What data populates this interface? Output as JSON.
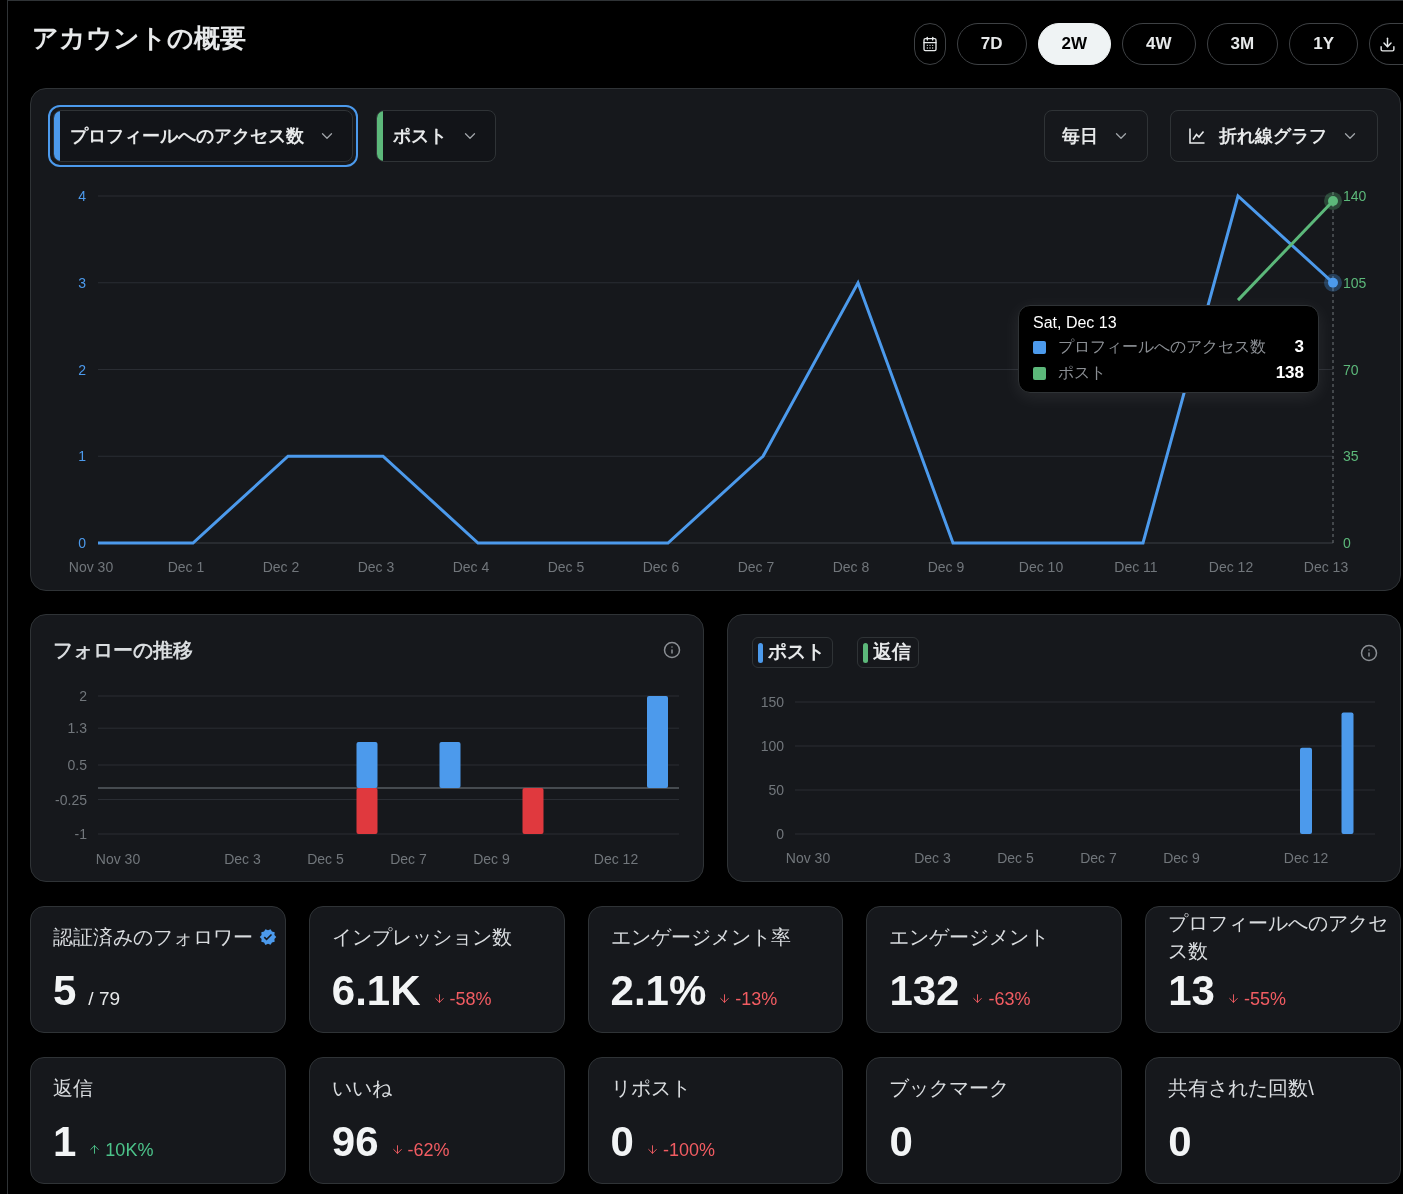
{
  "header": {
    "title": "アカウントの概要",
    "ranges": [
      {
        "label": "7D",
        "selected": false
      },
      {
        "label": "2W",
        "selected": true
      },
      {
        "label": "4W",
        "selected": false
      },
      {
        "label": "3M",
        "selected": false
      },
      {
        "label": "1Y",
        "selected": false
      }
    ]
  },
  "main_chart": {
    "metric_selectors": [
      {
        "label": "プロフィールへのアクセス数",
        "color": "#4c9aec",
        "focused": true
      },
      {
        "label": "ポスト",
        "color": "#5cb87a",
        "focused": false
      }
    ],
    "interval_selector": {
      "label": "毎日"
    },
    "chart_type_selector": {
      "label": "折れ線グラフ"
    },
    "chart_data": {
      "type": "line",
      "categories": [
        "Nov 30",
        "Dec 1",
        "Dec 2",
        "Dec 3",
        "Dec 4",
        "Dec 5",
        "Dec 6",
        "Dec 7",
        "Dec 8",
        "Dec 9",
        "Dec 10",
        "Dec 11",
        "Dec 12",
        "Dec 13"
      ],
      "series": [
        {
          "name": "プロフィールへのアクセス数",
          "color": "#4c9aec",
          "values": [
            0,
            0,
            1,
            1,
            0,
            0,
            0,
            1,
            3,
            0,
            0,
            0,
            4,
            3
          ]
        },
        {
          "name": "ポスト",
          "color": "#5cb87a",
          "axis": "y2",
          "values": [
            null,
            null,
            null,
            null,
            null,
            null,
            null,
            null,
            null,
            null,
            null,
            null,
            98,
            138
          ]
        }
      ],
      "ylim": [
        0,
        4
      ],
      "yticks": [
        0,
        1,
        2,
        3,
        4
      ],
      "y2lim": [
        0,
        140
      ],
      "y2ticks": [
        0,
        35,
        70,
        105,
        140
      ],
      "grid": true
    },
    "tooltip": {
      "title": "Sat, Dec 13",
      "values": [
        "3",
        "138"
      ]
    }
  },
  "follow_chart": {
    "title": "フォローの推移",
    "chart_data": {
      "type": "bar",
      "categories": [
        "Nov 30",
        null,
        null,
        "Dec 3",
        null,
        "Dec 5",
        null,
        "Dec 7",
        null,
        "Dec 9",
        null,
        null,
        "Dec 12",
        null
      ],
      "series": [
        {
          "color": "#4c9aec",
          "values": [
            0,
            0,
            0,
            0,
            0,
            0,
            1,
            0,
            1,
            0,
            0,
            0,
            0,
            2
          ]
        },
        {
          "color": "#e0393e",
          "values": [
            0,
            0,
            0,
            0,
            0,
            0,
            -1,
            0,
            0,
            0,
            -1,
            0,
            0,
            0
          ]
        }
      ],
      "ylim": [
        -1,
        2
      ],
      "yticks": [
        2,
        1.3,
        0.5,
        -0.25,
        -1
      ],
      "grid": true,
      "stacked": true
    }
  },
  "posts_chart": {
    "chart_data": {
      "type": "bar",
      "categories": [
        "Nov 30",
        null,
        null,
        "Dec 3",
        null,
        "Dec 5",
        null,
        "Dec 7",
        null,
        "Dec 9",
        null,
        null,
        "Dec 12",
        null
      ],
      "series": [
        {
          "name": "ポスト",
          "color": "#4c9aec",
          "values": [
            0,
            0,
            0,
            0,
            0,
            0,
            0,
            0,
            0,
            0,
            0,
            0,
            98,
            138
          ]
        },
        {
          "name": "返信",
          "color": "#5cb87a",
          "values": [
            0,
            0,
            0,
            0,
            0,
            0,
            0,
            0,
            0,
            0,
            0,
            0,
            0,
            0
          ]
        }
      ],
      "ylim": [
        0,
        150
      ],
      "yticks": [
        150,
        100,
        50,
        0
      ],
      "grid": true,
      "stacked": true
    }
  },
  "stats": [
    {
      "label": "認証済みのフォロワー",
      "verified": true,
      "value": "5",
      "suffix": "/ 79"
    },
    {
      "label": "インプレッション数",
      "verified": false,
      "value": "6.1K",
      "change": "-58%",
      "kind": "down"
    },
    {
      "label": "エンゲージメント率",
      "verified": false,
      "value": "2.1%",
      "change": "-13%",
      "kind": "down"
    },
    {
      "label": "エンゲージメント",
      "verified": false,
      "value": "132",
      "change": "-63%",
      "kind": "down"
    },
    {
      "label": "プロフィールへのアクセス数",
      "verified": false,
      "value": "13",
      "change": "-55%",
      "kind": "down"
    },
    {
      "label": "返信",
      "verified": false,
      "value": "1",
      "change": "10K%",
      "kind": "up"
    },
    {
      "label": "いいね",
      "verified": false,
      "value": "96",
      "change": "-62%",
      "kind": "down"
    },
    {
      "label": "リポスト",
      "verified": false,
      "value": "0",
      "change": "-100%",
      "kind": "down"
    },
    {
      "label": "ブックマーク",
      "verified": false,
      "value": "0"
    },
    {
      "label": "共有された回数\\",
      "verified": false,
      "value": "0"
    }
  ]
}
